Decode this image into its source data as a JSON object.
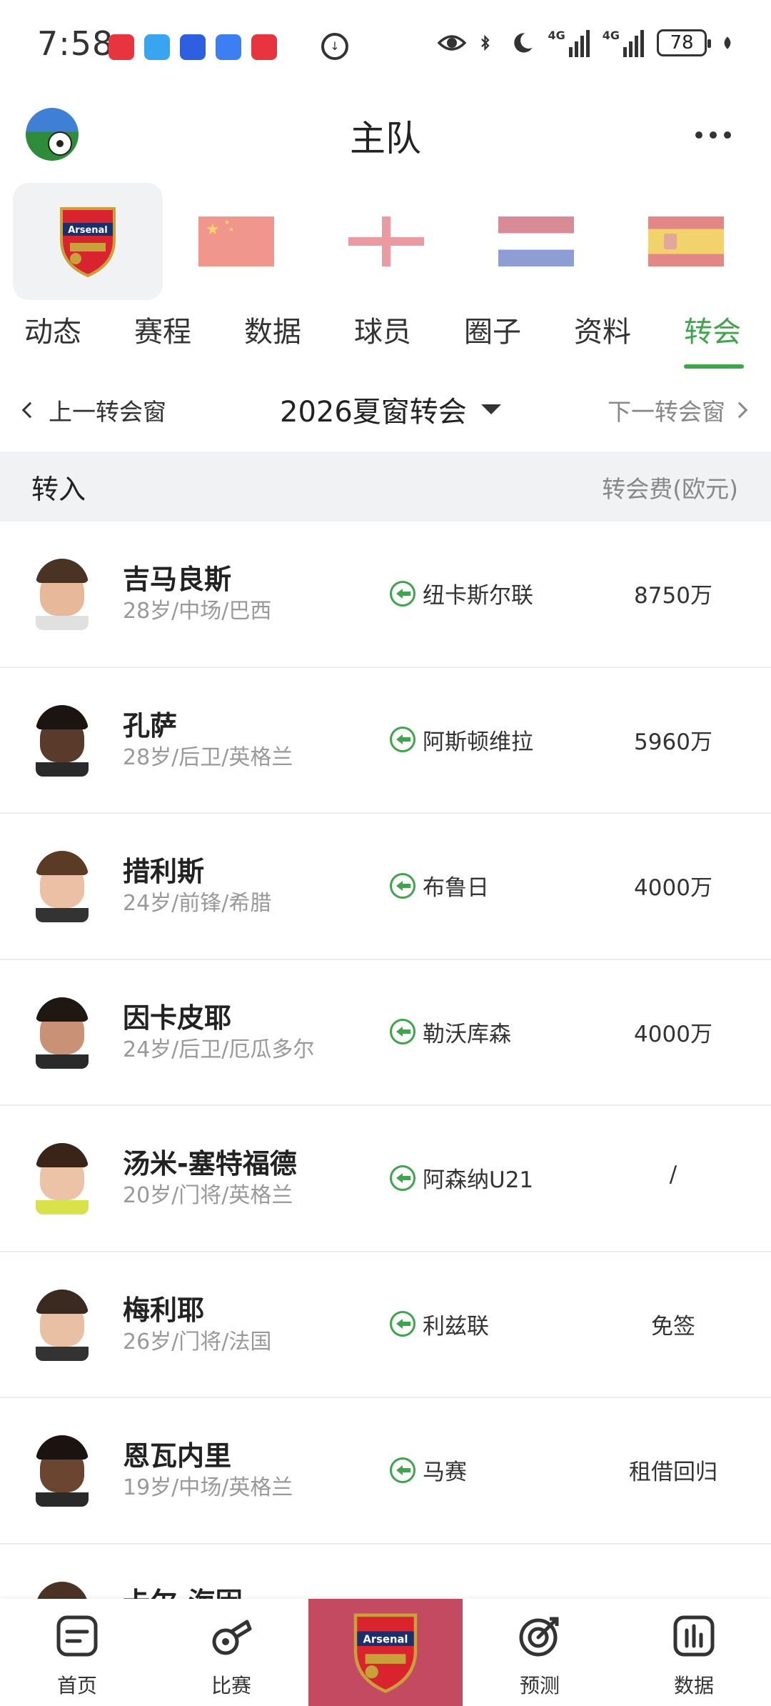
{
  "status_bar": {
    "time": "7:58",
    "battery": "78",
    "network": "4G"
  },
  "header": {
    "title": "主队"
  },
  "teams": [
    {
      "name": "Arsenal",
      "crest_text": "Arsenal",
      "active": true
    },
    {
      "name": "China",
      "flag": "china-flag-icon"
    },
    {
      "name": "England",
      "flag": "england-flag-icon"
    },
    {
      "name": "Netherlands",
      "flag": "netherlands-flag-icon"
    },
    {
      "name": "Spain",
      "flag": "spain-flag-icon"
    }
  ],
  "tabs": [
    {
      "label": "动态"
    },
    {
      "label": "赛程"
    },
    {
      "label": "数据"
    },
    {
      "label": "球员"
    },
    {
      "label": "圈子"
    },
    {
      "label": "资料"
    },
    {
      "label": "转会",
      "active": true
    }
  ],
  "window_nav": {
    "prev": "上一转会窗",
    "current": "2026夏窗转会",
    "next": "下一转会窗"
  },
  "section": {
    "title": "转入",
    "fee_header": "转会费(欧元)"
  },
  "transfers": [
    {
      "name": "吉马良斯",
      "info": "28岁/中场/巴西",
      "from": "纽卡斯尔联",
      "fee": "8750万"
    },
    {
      "name": "孔萨",
      "info": "28岁/后卫/英格兰",
      "from": "阿斯顿维拉",
      "fee": "5960万"
    },
    {
      "name": "措利斯",
      "info": "24岁/前锋/希腊",
      "from": "布鲁日",
      "fee": "4000万"
    },
    {
      "name": "因卡皮耶",
      "info": "24岁/后卫/厄瓜多尔",
      "from": "勒沃库森",
      "fee": "4000万"
    },
    {
      "name": "汤米-塞特福德",
      "info": "20岁/门将/英格兰",
      "from": "阿森纳U21",
      "fee": "/"
    },
    {
      "name": "梅利耶",
      "info": "26岁/门将/法国",
      "from": "利兹联",
      "fee": "免签"
    },
    {
      "name": "恩瓦内里",
      "info": "19岁/中场/英格兰",
      "from": "马赛",
      "fee": "租借回归"
    },
    {
      "name": "卡尔-海因",
      "info": "",
      "from": "",
      "fee": ""
    }
  ],
  "bottom_nav": {
    "items": [
      {
        "label": "首页",
        "icon": "home-icon"
      },
      {
        "label": "比赛",
        "icon": "whistle-icon"
      },
      {
        "label": "",
        "icon": "arsenal-crest-icon"
      },
      {
        "label": "预测",
        "icon": "target-icon"
      },
      {
        "label": "数据",
        "icon": "bar-chart-icon"
      }
    ]
  },
  "colors": {
    "accent": "#3da54a",
    "center_tab": "#c34a60",
    "section_bg": "#f1f2f4"
  }
}
